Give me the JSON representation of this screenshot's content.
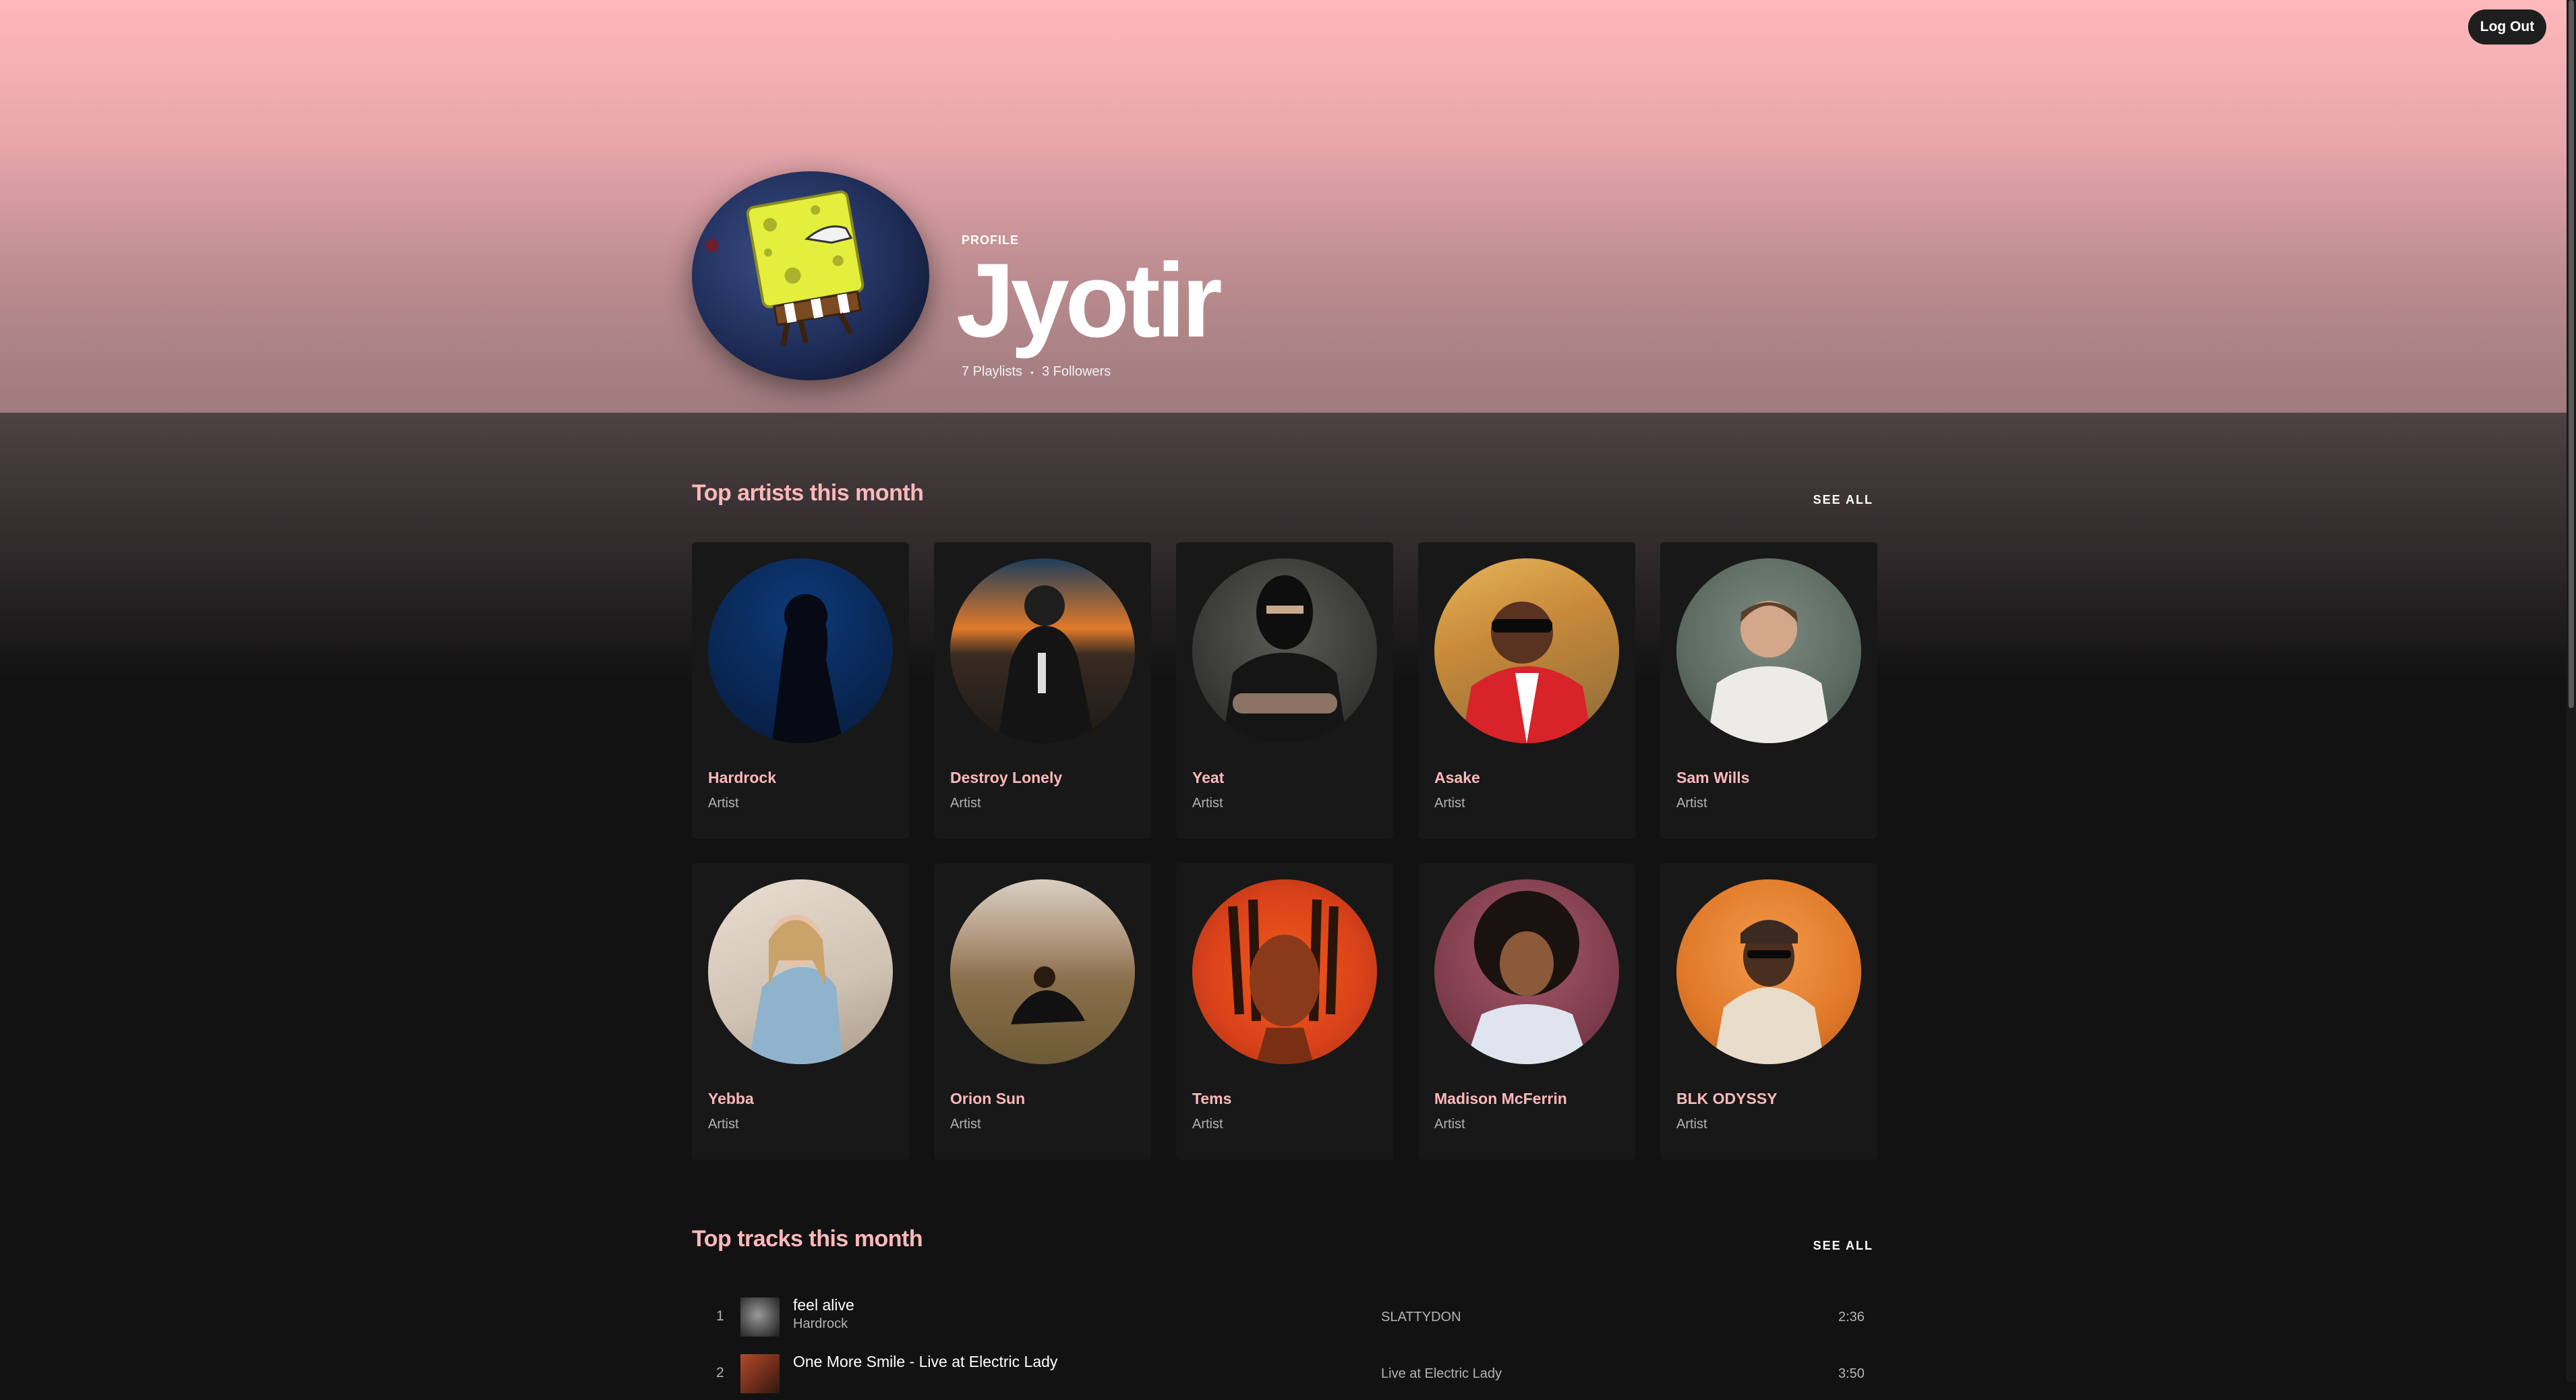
{
  "header": {
    "logout_label": "Log Out"
  },
  "profile": {
    "label": "PROFILE",
    "name": "Jyotir",
    "playlists": "7 Playlists",
    "separator": "•",
    "followers": "3 Followers"
  },
  "top_artists": {
    "title": "Top artists this month",
    "see_all": "SEE ALL",
    "items": [
      {
        "name": "Hardrock",
        "type": "Artist"
      },
      {
        "name": "Destroy Lonely",
        "type": "Artist"
      },
      {
        "name": "Yeat",
        "type": "Artist"
      },
      {
        "name": "Asake",
        "type": "Artist"
      },
      {
        "name": "Sam Wills",
        "type": "Artist"
      },
      {
        "name": "Yebba",
        "type": "Artist"
      },
      {
        "name": "Orion Sun",
        "type": "Artist"
      },
      {
        "name": "Tems",
        "type": "Artist"
      },
      {
        "name": "Madison McFerrin",
        "type": "Artist"
      },
      {
        "name": "BLK ODYSSY",
        "type": "Artist"
      }
    ]
  },
  "top_tracks": {
    "title": "Top tracks this month",
    "see_all": "SEE ALL",
    "items": [
      {
        "num": "1",
        "title": "feel alive",
        "artist": "Hardrock",
        "album": "SLATTYDON",
        "duration": "2:36"
      },
      {
        "num": "2",
        "title": "One More Smile - Live at Electric Lady",
        "artist": "",
        "album": "Live at Electric Lady",
        "duration": "3:50"
      }
    ]
  },
  "colors": {
    "accent_pink": "#ffb8bb",
    "background": "#121212",
    "card": "#181818",
    "muted_text": "#b3b3b3"
  }
}
